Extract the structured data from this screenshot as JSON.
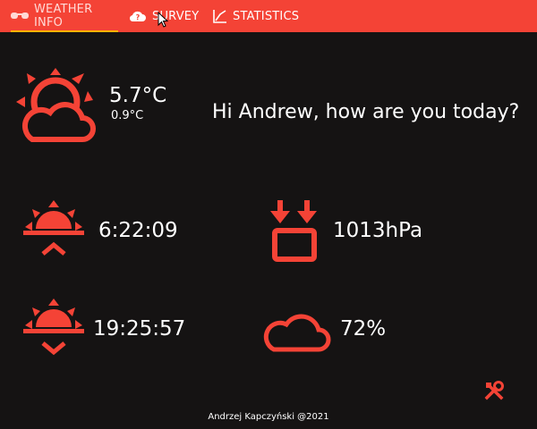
{
  "tabs": [
    {
      "label": "WEATHER INFO",
      "icon": "glasses-icon",
      "active": true
    },
    {
      "label": "SURVEY",
      "icon": "cloud-question-icon",
      "active": false
    },
    {
      "label": "STATISTICS",
      "icon": "chart-line-icon",
      "active": false
    }
  ],
  "current": {
    "temperature": "5.7°C",
    "feels_like": "0.9°C",
    "icon": "partly-cloudy-sun-icon"
  },
  "greeting": "Hi Andrew, how are you today?",
  "sunrise": {
    "time": "6:22:09",
    "icon": "sunrise-icon"
  },
  "sunset": {
    "time": "19:25:57",
    "icon": "sunset-icon"
  },
  "pressure": {
    "value": "1013hPa",
    "icon": "pressure-icon"
  },
  "humidity": {
    "value": "72%",
    "icon": "cloud-icon"
  },
  "settings_icon": "tools-icon",
  "footer": "Andrzej Kapczyński @2021",
  "colors": {
    "accent": "#f44336",
    "background": "#151313",
    "tab_indicator": "#ffb300"
  }
}
